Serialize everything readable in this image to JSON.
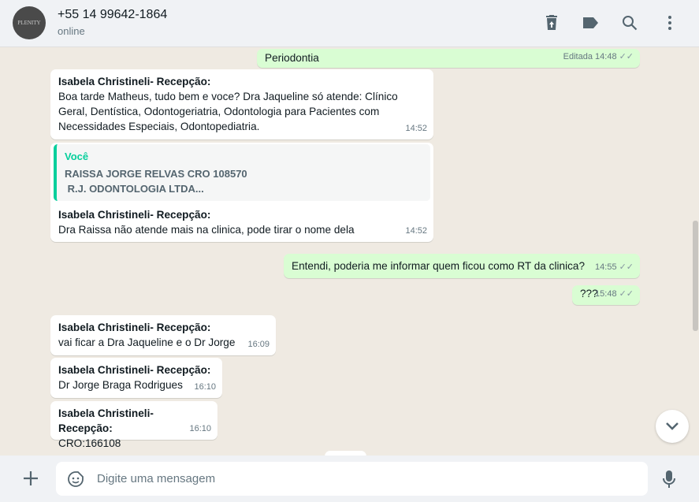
{
  "header": {
    "avatar_text": "PLENITY",
    "title": "+55 14 99642-1864",
    "status": "online"
  },
  "messages": [
    {
      "dir": "out",
      "text": "Periodontia",
      "edited": "Editada",
      "time": "14:48"
    },
    {
      "dir": "in",
      "sender": "Isabela Christineli- Recepção:",
      "text": "Boa tarde Matheus, tudo bem e voce? Dra Jaqueline só atende: Clínico Geral, Dentística, Odontogeriatria, Odontologia para Pacientes com Necessidades Especiais, Odontopediatria.",
      "time": "14:52"
    },
    {
      "dir": "in",
      "quote": {
        "name": "Você",
        "line1": "RAISSA JORGE RELVAS CRO 108570",
        "line2": " R.J. ODONTOLOGIA LTDA..."
      },
      "sender": "Isabela Christineli- Recepção:",
      "text": "Dra Raissa não atende mais na clinica, pode tirar o nome dela",
      "time": "14:52"
    },
    {
      "dir": "out",
      "text": "Entendi, poderia me informar quem ficou como RT da clinica?",
      "time": "14:55"
    },
    {
      "dir": "out",
      "text": "???",
      "time": "15:48"
    },
    {
      "dir": "in",
      "sender": "Isabela Christineli- Recepção:",
      "text": "vai ficar a Dra Jaqueline e o Dr Jorge",
      "time": "16:09"
    },
    {
      "dir": "in",
      "sender": "Isabela Christineli- Recepção:",
      "text": "Dr Jorge Braga Rodrigues",
      "time": "16:10"
    },
    {
      "dir": "in",
      "sender": "Isabela Christineli- Recepção:",
      "text": "CRO:166108",
      "time": "16:10"
    }
  ],
  "composer": {
    "placeholder": "Digite uma mensagem"
  }
}
